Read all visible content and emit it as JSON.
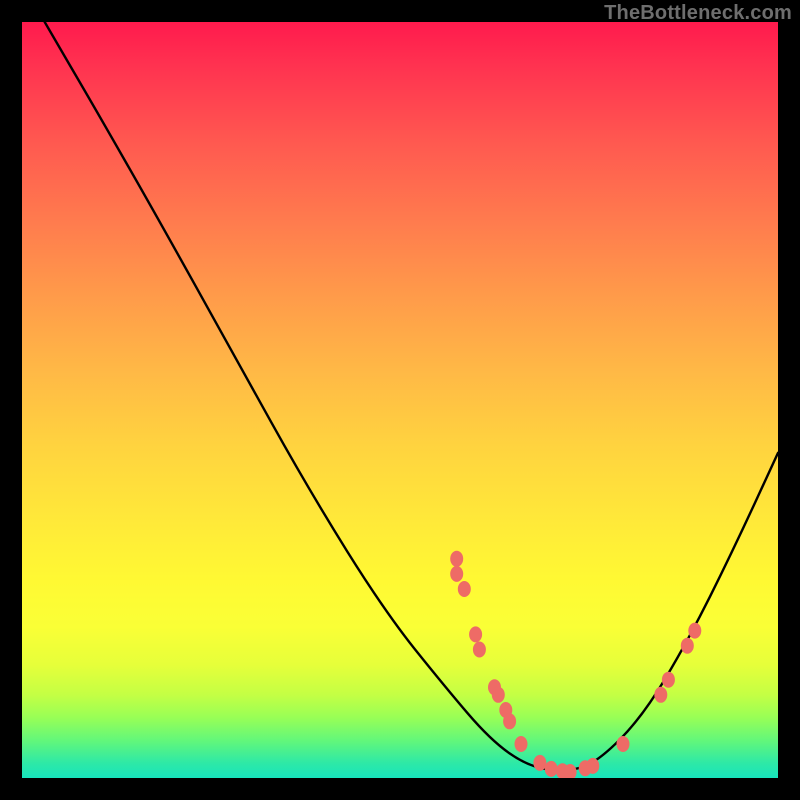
{
  "watermark": "TheBottleneck.com",
  "chart_data": {
    "type": "line",
    "title": "",
    "xlabel": "",
    "ylabel": "",
    "xlim": [
      0,
      100
    ],
    "ylim": [
      0,
      100
    ],
    "curve": [
      {
        "x": 3,
        "y": 100
      },
      {
        "x": 10,
        "y": 88
      },
      {
        "x": 18,
        "y": 74
      },
      {
        "x": 28,
        "y": 56
      },
      {
        "x": 38,
        "y": 38
      },
      {
        "x": 48,
        "y": 22
      },
      {
        "x": 56,
        "y": 12
      },
      {
        "x": 62,
        "y": 5
      },
      {
        "x": 67,
        "y": 1.5
      },
      {
        "x": 72,
        "y": 0.8
      },
      {
        "x": 76,
        "y": 2
      },
      {
        "x": 82,
        "y": 8
      },
      {
        "x": 88,
        "y": 18
      },
      {
        "x": 94,
        "y": 30
      },
      {
        "x": 100,
        "y": 43
      }
    ],
    "markers": [
      {
        "x": 57.5,
        "y": 29
      },
      {
        "x": 57.5,
        "y": 27
      },
      {
        "x": 58.5,
        "y": 25
      },
      {
        "x": 60.0,
        "y": 19
      },
      {
        "x": 60.5,
        "y": 17
      },
      {
        "x": 62.5,
        "y": 12
      },
      {
        "x": 63.0,
        "y": 11
      },
      {
        "x": 64.0,
        "y": 9
      },
      {
        "x": 64.5,
        "y": 7.5
      },
      {
        "x": 66.0,
        "y": 4.5
      },
      {
        "x": 68.5,
        "y": 2
      },
      {
        "x": 70.0,
        "y": 1.2
      },
      {
        "x": 71.5,
        "y": 0.9
      },
      {
        "x": 72.5,
        "y": 0.8
      },
      {
        "x": 74.5,
        "y": 1.3
      },
      {
        "x": 75.5,
        "y": 1.6
      },
      {
        "x": 79.5,
        "y": 4.5
      },
      {
        "x": 84.5,
        "y": 11
      },
      {
        "x": 85.5,
        "y": 13
      },
      {
        "x": 88.0,
        "y": 17.5
      },
      {
        "x": 89.0,
        "y": 19.5
      }
    ],
    "marker_color": "#ee6b66",
    "curve_color": "#000000"
  }
}
